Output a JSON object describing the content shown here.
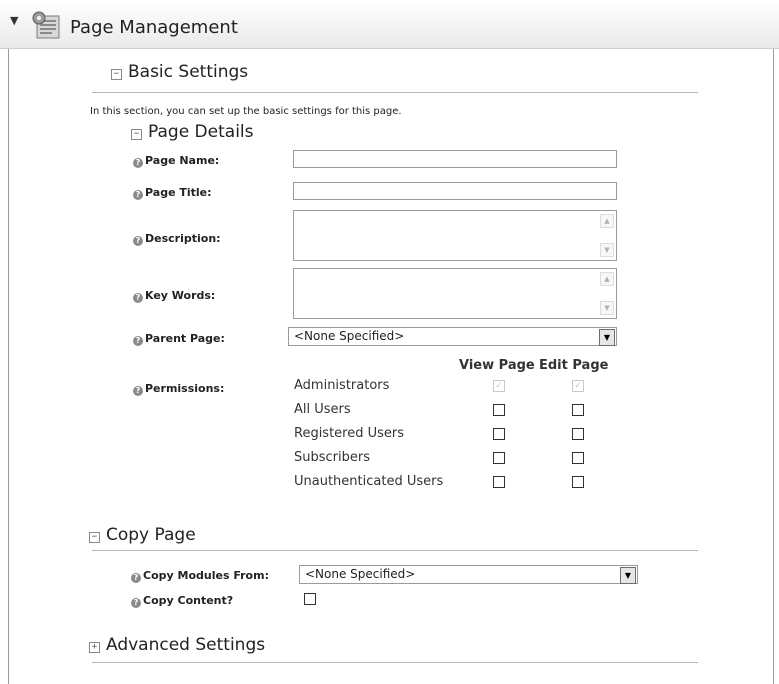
{
  "header": {
    "title": "Page Management"
  },
  "basic": {
    "title": "Basic Settings",
    "toggle": "−",
    "intro": "In this section, you can set up the basic settings for this page."
  },
  "details": {
    "title": "Page Details",
    "toggle": "−",
    "page_name": {
      "label": "Page Name:",
      "value": ""
    },
    "page_title": {
      "label": "Page Title:",
      "value": ""
    },
    "description": {
      "label": "Description:",
      "value": ""
    },
    "keywords": {
      "label": "Key Words:",
      "value": ""
    },
    "parent_page": {
      "label": "Parent Page:",
      "value": "<None Specified>"
    },
    "permissions": {
      "label": "Permissions:",
      "col_view": "View Page",
      "col_edit": "Edit Page",
      "rows": [
        {
          "role": "Administrators",
          "view": true,
          "edit": true,
          "disabled": true
        },
        {
          "role": "All Users",
          "view": false,
          "edit": false
        },
        {
          "role": "Registered Users",
          "view": false,
          "edit": false
        },
        {
          "role": "Subscribers",
          "view": false,
          "edit": false
        },
        {
          "role": "Unauthenticated Users",
          "view": false,
          "edit": false
        }
      ]
    }
  },
  "copy": {
    "title": "Copy Page",
    "toggle": "−",
    "modules_label": "Copy Modules From:",
    "modules_value": "<None Specified>",
    "content_label": "Copy Content?"
  },
  "advanced": {
    "title": "Advanced Settings",
    "toggle": "+"
  },
  "icons": {
    "help": "?",
    "check": "✓",
    "dropdown": "▼",
    "up": "▲",
    "down": "▼"
  }
}
